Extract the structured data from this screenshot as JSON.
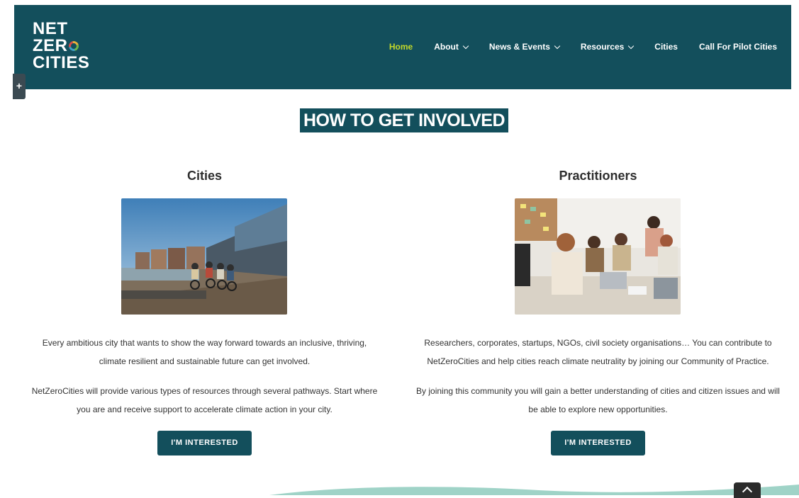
{
  "logo": {
    "line1": "NET",
    "line2_prefix": "ZER",
    "line3": "CITIES"
  },
  "nav": {
    "items": [
      {
        "label": "Home",
        "active": true,
        "dropdown": false
      },
      {
        "label": "About",
        "active": false,
        "dropdown": true
      },
      {
        "label": "News & Events",
        "active": false,
        "dropdown": true
      },
      {
        "label": "Resources",
        "active": false,
        "dropdown": true
      },
      {
        "label": "Cities",
        "active": false,
        "dropdown": false
      },
      {
        "label": "Call For Pilot Cities",
        "active": false,
        "dropdown": false
      }
    ]
  },
  "side_tab": {
    "label": "+"
  },
  "section_title": "HOW TO GET INVOLVED",
  "columns": {
    "cities": {
      "heading": "Cities",
      "para1": "Every ambitious city that wants to show the way forward towards an inclusive, thriving, climate resilient and sustainable future can get involved.",
      "para2": "NetZeroCities will provide various types of resources through several pathways. Start where you are and receive support to accelerate climate action in your city.",
      "button": "I'M INTERESTED"
    },
    "practitioners": {
      "heading": "Practitioners",
      "para1": "Researchers, corporates, startups, NGOs, civil society organisations… You can contribute to NetZeroCities and help cities reach climate neutrality by joining our Community of Practice.",
      "para2": "By joining this community you will gain a better understanding of cities and citizen issues and will be able to explore new opportunities.",
      "button": "I'M INTERESTED"
    }
  },
  "colors": {
    "brand": "#134f5c",
    "nav_active": "#c3d82a",
    "wave": "#9fd3c7"
  },
  "icons": {
    "scroll_top": "chevron-up-icon",
    "dropdown": "chevron-down-icon"
  }
}
